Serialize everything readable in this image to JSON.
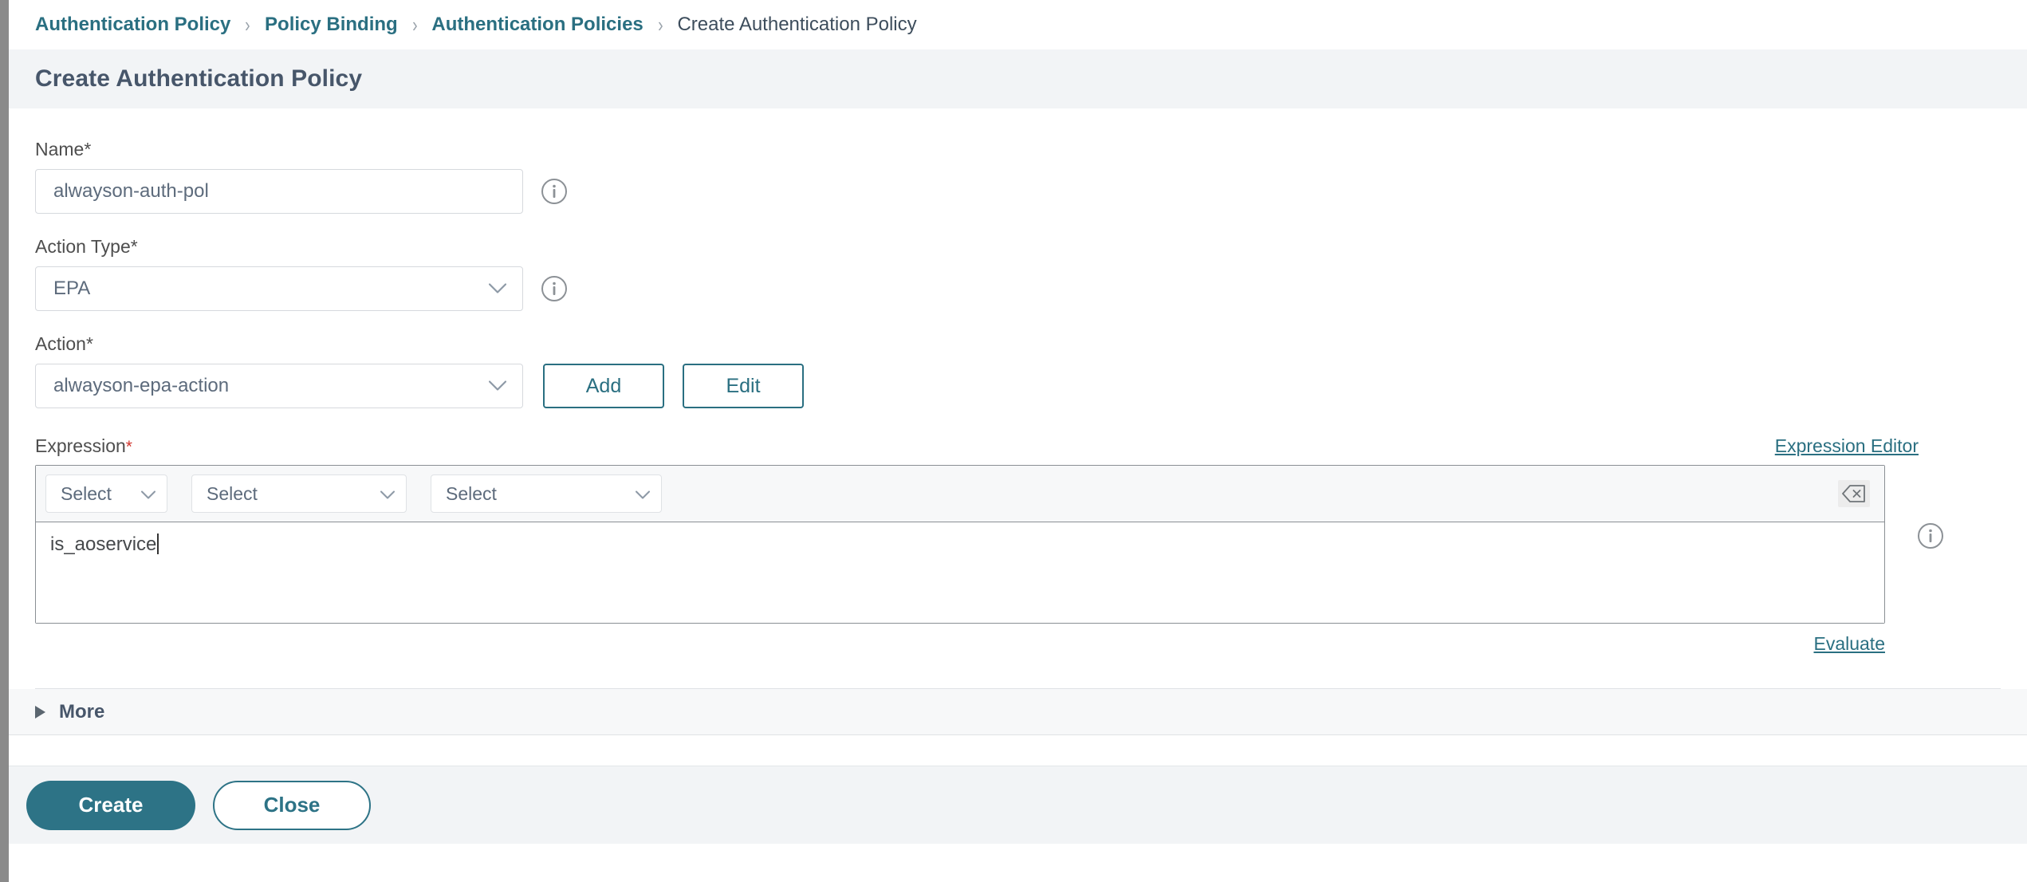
{
  "breadcrumb": {
    "items": [
      {
        "label": "Authentication Policy",
        "current": false
      },
      {
        "label": "Policy Binding",
        "current": false
      },
      {
        "label": "Authentication Policies",
        "current": false
      },
      {
        "label": "Create Authentication Policy",
        "current": true
      }
    ],
    "separator": "›"
  },
  "header": {
    "title": "Create Authentication Policy"
  },
  "form": {
    "name": {
      "label": "Name",
      "required_marker": "*",
      "value": "alwayson-auth-pol",
      "placeholder": "",
      "info_icon": "info-icon"
    },
    "action_type": {
      "label": "Action Type",
      "required_marker": "*",
      "value": "EPA",
      "info_icon": "info-icon",
      "chevron_icon": "chevron-down-icon"
    },
    "action": {
      "label": "Action",
      "required_marker": "*",
      "value": "alwayson-epa-action",
      "chevron_icon": "chevron-down-icon",
      "add_label": "Add",
      "edit_label": "Edit"
    },
    "expression": {
      "label": "Expression",
      "required_marker": "*",
      "editor_link": "Expression Editor",
      "selects": [
        {
          "value": "Select",
          "chevron_icon": "chevron-down-icon"
        },
        {
          "value": "Select",
          "chevron_icon": "chevron-down-icon"
        },
        {
          "value": "Select",
          "chevron_icon": "chevron-down-icon"
        }
      ],
      "clear_icon": "backspace-clear-icon",
      "text_value": "is_aoservice",
      "evaluate_link": "Evaluate",
      "info_icon": "info-icon"
    }
  },
  "more_section": {
    "label": "More",
    "arrow_icon": "triangle-right-icon",
    "expanded": false
  },
  "footer": {
    "create_label": "Create",
    "close_label": "Close"
  },
  "colors": {
    "accent_teal": "#2d7386",
    "link_teal": "#2a6f81",
    "title_text": "#47566a",
    "panel_bg": "#f2f4f6",
    "required_red": "#d0342c",
    "border_gray": "#d6d9dd"
  }
}
